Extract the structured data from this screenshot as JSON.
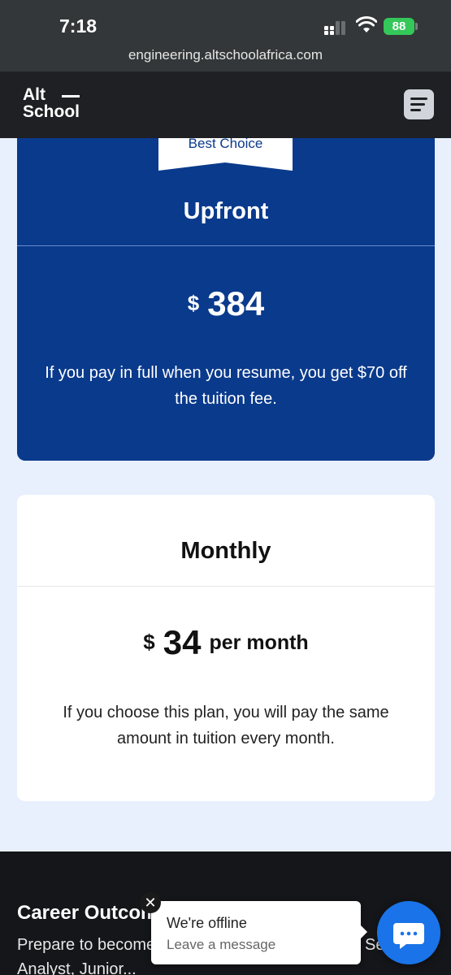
{
  "status_bar": {
    "time": "7:18",
    "battery": "88"
  },
  "browser": {
    "url": "engineering.altschoolafrica.com"
  },
  "site_header": {
    "logo_line1": "Alt",
    "logo_line2": "School"
  },
  "upfront_plan": {
    "badge": "Best Choice",
    "title": "Upfront",
    "currency": "$",
    "amount": "384",
    "description": "If you pay in full when you resume, you get $70 off the tuition fee."
  },
  "monthly_plan": {
    "title": "Monthly",
    "currency": "$",
    "amount": "34",
    "period": "per month",
    "description": "If you choose this plan, you will pay the same amount in tuition every month."
  },
  "career_section": {
    "title": "Career Outcomes",
    "description": "Prepare to become ... can occupy roles such as Security Analyst, Junior..."
  },
  "chat_widget": {
    "close": "✕",
    "title": "We're offline",
    "subtitle": "Leave a message"
  }
}
